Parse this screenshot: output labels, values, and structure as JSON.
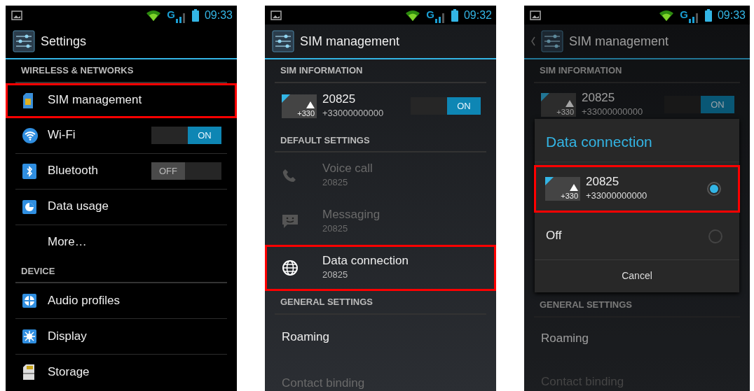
{
  "screens": [
    {
      "status": {
        "network": "G",
        "time": "09:33"
      },
      "title": "Settings",
      "up": false,
      "sections": [
        {
          "header": "WIRELESS & NETWORKS",
          "items": [
            {
              "kind": "sim",
              "label": "SIM management",
              "highlighted": true
            },
            {
              "kind": "wifi",
              "label": "Wi-Fi",
              "highlighted": false,
              "toggle": {
                "on": true,
                "text": "ON"
              }
            },
            {
              "kind": "bluetooth",
              "label": "Bluetooth",
              "highlighted": false,
              "toggle": {
                "on": false,
                "text": "OFF"
              }
            },
            {
              "kind": "data-usage",
              "label": "Data usage",
              "highlighted": false
            },
            {
              "kind": "plain",
              "label": "More…",
              "highlighted": false
            }
          ]
        },
        {
          "header": "DEVICE",
          "items": [
            {
              "kind": "audio",
              "label": "Audio profiles",
              "highlighted": false
            },
            {
              "kind": "display",
              "label": "Display",
              "highlighted": false
            },
            {
              "kind": "storage",
              "label": "Storage",
              "highlighted": false
            }
          ]
        }
      ]
    },
    {
      "status": {
        "network": "G",
        "time": "09:32"
      },
      "title": "SIM management",
      "up": false,
      "sections": [
        {
          "header": "SIM INFORMATION",
          "items": [
            {
              "kind": "sim-badge",
              "badge": "+330",
              "label": "20825",
              "subtitle": "+33000000000",
              "highlighted": false,
              "disabled": false,
              "toggle": {
                "on": true,
                "text": "ON"
              }
            }
          ]
        },
        {
          "header": "DEFAULT SETTINGS",
          "items": [
            {
              "kind": "phone",
              "label": "Voice call",
              "subtitle": "20825",
              "highlighted": false,
              "disabled": true
            },
            {
              "kind": "message",
              "label": "Messaging",
              "subtitle": "20825",
              "highlighted": false,
              "disabled": true
            },
            {
              "kind": "globe",
              "label": "Data connection",
              "subtitle": "20825",
              "highlighted": true,
              "disabled": false
            }
          ]
        },
        {
          "header": "GENERAL SETTINGS",
          "items": [
            {
              "label": "Roaming",
              "highlighted": false,
              "disabled": false
            },
            {
              "label": "Contact binding",
              "highlighted": false,
              "disabled": true
            }
          ]
        }
      ]
    },
    {
      "status": {
        "network": "G",
        "time": "09:33"
      },
      "title": "SIM management",
      "up": true,
      "sections": [
        {
          "header": "SIM INFORMATION",
          "items": [
            {
              "kind": "sim-badge",
              "badge": "+330",
              "label": "20825",
              "subtitle": "+33000000000",
              "highlighted": false,
              "disabled": false,
              "toggle": {
                "on": true,
                "text": "ON"
              }
            }
          ]
        },
        {
          "header": "GENERAL SETTINGS",
          "items": [
            {
              "label": "Roaming",
              "highlighted": false,
              "disabled": false
            },
            {
              "label": "Contact binding",
              "highlighted": false,
              "disabled": true
            }
          ]
        }
      ],
      "dialog": {
        "title": "Data connection",
        "options": [
          {
            "kind": "sim",
            "badge": "+330",
            "label": "20825",
            "subtitle": "+33000000000",
            "selected": true,
            "highlighted": true
          },
          {
            "kind": "plain",
            "label": "Off",
            "selected": false,
            "highlighted": false
          }
        ],
        "button": "Cancel"
      }
    }
  ]
}
